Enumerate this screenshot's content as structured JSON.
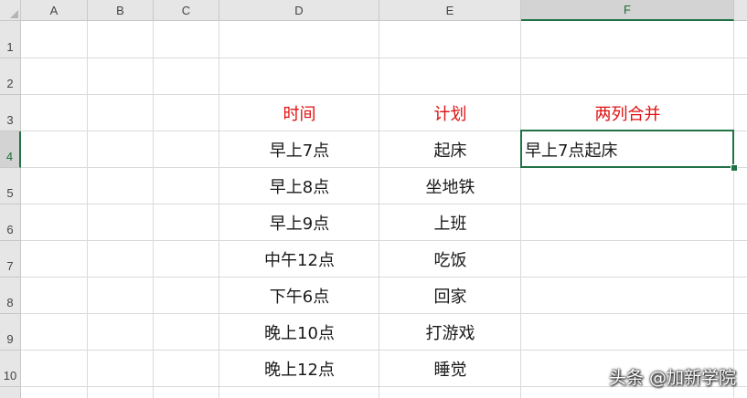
{
  "columns": [
    "A",
    "B",
    "C",
    "D",
    "E",
    "F"
  ],
  "rows": [
    "1",
    "2",
    "3",
    "4",
    "5",
    "6",
    "7",
    "8",
    "9",
    "10"
  ],
  "selected_column": "F",
  "selected_row": "4",
  "headers": {
    "time": "时间",
    "plan": "计划",
    "merge": "两列合并"
  },
  "data_rows": [
    {
      "time": "早上7点",
      "plan": "起床",
      "merged": "早上7点起床"
    },
    {
      "time": "早上8点",
      "plan": "坐地铁",
      "merged": ""
    },
    {
      "time": "早上9点",
      "plan": "上班",
      "merged": ""
    },
    {
      "time": "中午12点",
      "plan": "吃饭",
      "merged": ""
    },
    {
      "time": "下午6点",
      "plan": "回家",
      "merged": ""
    },
    {
      "time": "晚上10点",
      "plan": "打游戏",
      "merged": ""
    },
    {
      "time": "晚上12点",
      "plan": "睡觉",
      "merged": ""
    }
  ],
  "header_color": "#e01010",
  "accent_color": "#217346",
  "watermark": "头条 @加新学院"
}
